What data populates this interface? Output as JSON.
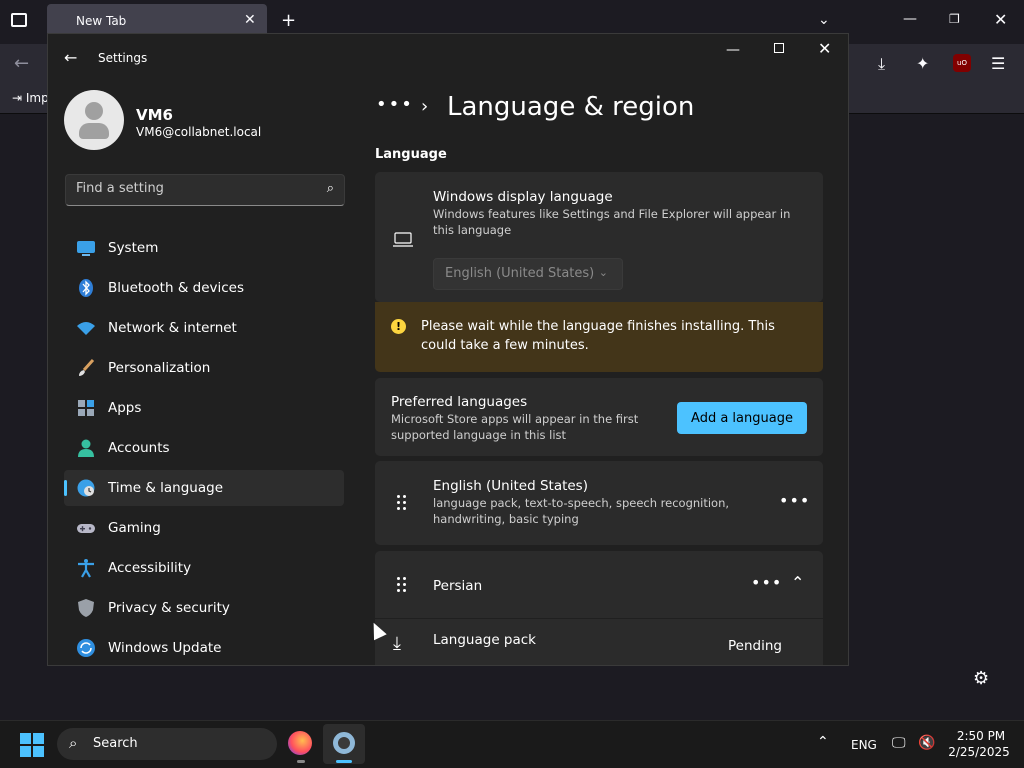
{
  "firefox": {
    "tab_title": "New Tab",
    "tab_close": "✕",
    "new_tab": "+",
    "list_all": "⌄",
    "bookmark_import": "⇥ Imp"
  },
  "settings": {
    "window_title": "Settings",
    "user": {
      "name": "VM6",
      "email": "VM6@collabnet.local"
    },
    "search_placeholder": "Find a setting",
    "nav": [
      {
        "label": "System",
        "icon": "system-icon",
        "selected": false
      },
      {
        "label": "Bluetooth & devices",
        "icon": "bluetooth-icon",
        "selected": false
      },
      {
        "label": "Network & internet",
        "icon": "wifi-icon",
        "selected": false
      },
      {
        "label": "Personalization",
        "icon": "brush-icon",
        "selected": false
      },
      {
        "label": "Apps",
        "icon": "apps-icon",
        "selected": false
      },
      {
        "label": "Accounts",
        "icon": "accounts-icon",
        "selected": false
      },
      {
        "label": "Time & language",
        "icon": "globe-clock-icon",
        "selected": true
      },
      {
        "label": "Gaming",
        "icon": "gamepad-icon",
        "selected": false
      },
      {
        "label": "Accessibility",
        "icon": "accessibility-icon",
        "selected": false
      },
      {
        "label": "Privacy & security",
        "icon": "shield-icon",
        "selected": false
      },
      {
        "label": "Windows Update",
        "icon": "update-icon",
        "selected": false
      }
    ],
    "page": {
      "breadcrumb_dots": "•••",
      "title": "Language & region",
      "section_language": "Language",
      "display_language": {
        "title": "Windows display language",
        "subtitle": "Windows features like Settings and File Explorer will appear in this language",
        "value": "English (United States)"
      },
      "warning": "Please wait while the language finishes installing. This could take a few minutes.",
      "preferred": {
        "title": "Preferred languages",
        "subtitle": "Microsoft Store apps will appear in the first supported language in this list",
        "button": "Add a language"
      },
      "languages": [
        {
          "name": "English (United States)",
          "features": "language pack, text-to-speech, speech recognition, handwriting, basic typing"
        },
        {
          "name": "Persian",
          "features": ""
        }
      ],
      "language_pack": {
        "label": "Language pack",
        "status": "Pending"
      }
    }
  },
  "taskbar": {
    "search_label": "Search",
    "tray_language": "ENG",
    "time": "2:50 PM",
    "date": "2/25/2025"
  },
  "colors": {
    "accent": "#4cc2ff",
    "warning_bg": "#433519",
    "window_bg": "#202020",
    "card_bg": "#2b2b2b"
  }
}
